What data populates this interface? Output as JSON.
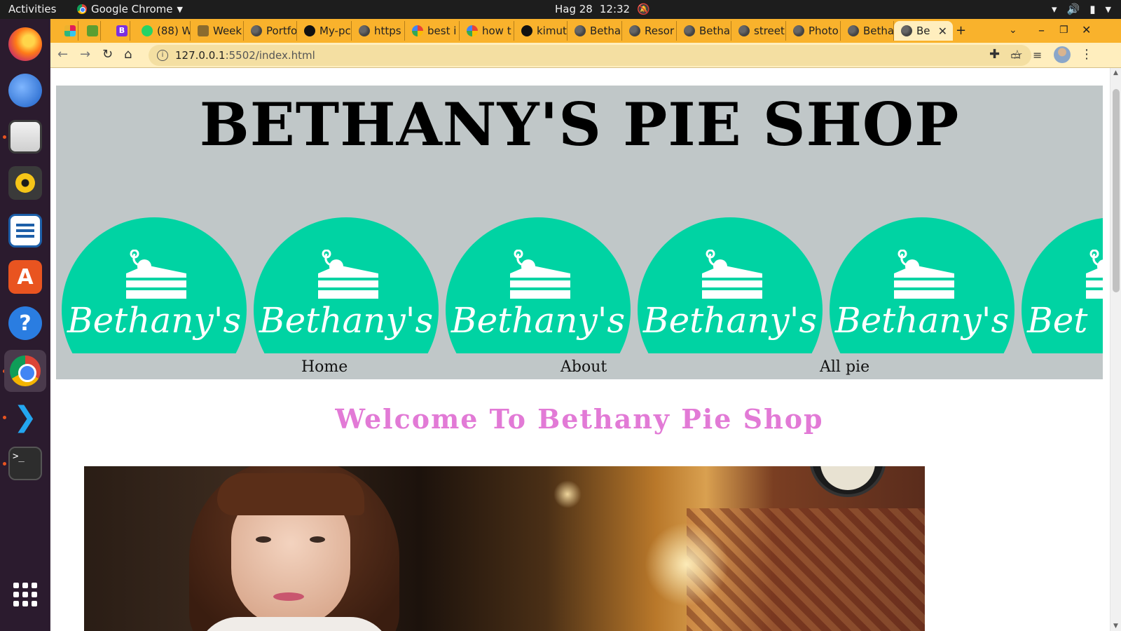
{
  "system_bar": {
    "activities": "Activities",
    "app_name": "Google Chrome",
    "date": "Hag 28",
    "time": "12:32"
  },
  "dock": {
    "apps": [
      "Firefox",
      "Thunderbird",
      "Files",
      "Rhythmbox",
      "LibreOffice Writer",
      "Ubuntu Software",
      "Help",
      "Google Chrome",
      "Visual Studio Code",
      "Terminal",
      "Show Applications"
    ]
  },
  "browser": {
    "tabs": [
      {
        "label": "",
        "icon": "slack-icon"
      },
      {
        "label": "",
        "icon": "shopify-icon"
      },
      {
        "label": "",
        "icon": "b-icon"
      },
      {
        "label": "(88) W",
        "icon": "whatsapp-icon"
      },
      {
        "label": "Week",
        "icon": "palm-icon"
      },
      {
        "label": "Portfo",
        "icon": "globe-icon"
      },
      {
        "label": "My-pc",
        "icon": "github-icon"
      },
      {
        "label": "https",
        "icon": "globe-icon"
      },
      {
        "label": "best i",
        "icon": "google-icon"
      },
      {
        "label": "how t",
        "icon": "google-icon"
      },
      {
        "label": "kimut",
        "icon": "github-icon"
      },
      {
        "label": "Betha",
        "icon": "globe-icon"
      },
      {
        "label": "Resor",
        "icon": "globe-icon"
      },
      {
        "label": "Betha",
        "icon": "globe-icon"
      },
      {
        "label": "street",
        "icon": "globe-icon"
      },
      {
        "label": "Photo",
        "icon": "globe-icon"
      },
      {
        "label": "Betha",
        "icon": "globe-icon"
      },
      {
        "label": "Be",
        "icon": "globe-icon",
        "active": true
      }
    ],
    "url_host": "127.0.0.1",
    "url_path": ":5502/index.html"
  },
  "page": {
    "title": "BETHANY'S PIE SHOP",
    "logo_text": "Bethany's",
    "logo_partial_text": "Bet",
    "nav": {
      "home": "Home",
      "about": "About",
      "all_pie": "All pie"
    },
    "welcome": "Welcome To Bethany Pie Shop"
  },
  "colors": {
    "header_bg": "#c0c7c8",
    "logo_teal": "#00d3a3",
    "welcome_pink": "#e27ad6",
    "chrome_tabstrip": "#f9b22c",
    "chrome_toolbar": "#ffeebe"
  }
}
